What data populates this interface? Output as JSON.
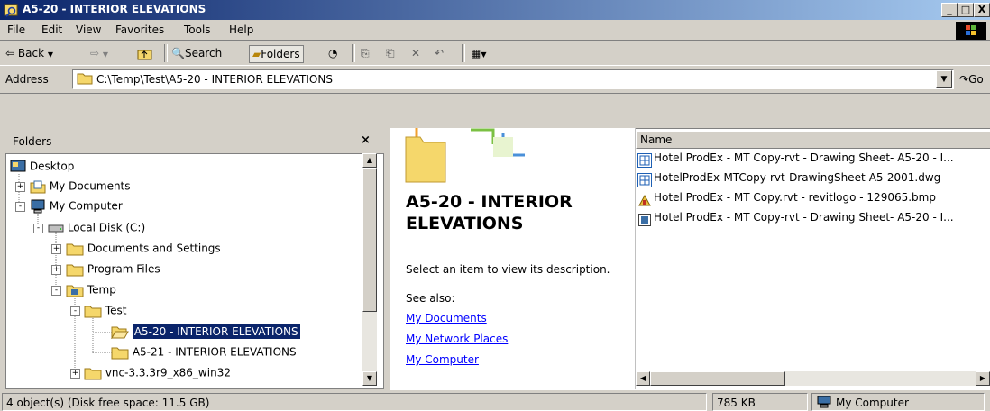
{
  "window": {
    "title": "A5-20 - INTERIOR ELEVATIONS",
    "minimize": "_",
    "maximize": "□",
    "close": "X"
  },
  "menu": [
    "File",
    "Edit",
    "View",
    "Favorites",
    "Tools",
    "Help"
  ],
  "toolbar": {
    "back": "Back",
    "search": "Search",
    "folders": "Folders"
  },
  "address": {
    "label": "Address",
    "value": "C:\\Temp\\Test\\A5-20 - INTERIOR ELEVATIONS",
    "go": "Go"
  },
  "folders_pane": {
    "title": "Folders",
    "close": "×",
    "tree": [
      {
        "label": "Desktop",
        "level": 0,
        "expander": ""
      },
      {
        "label": "My Documents",
        "level": 1,
        "expander": "+"
      },
      {
        "label": "My Computer",
        "level": 1,
        "expander": "-"
      },
      {
        "label": "Local Disk (C:)",
        "level": 2,
        "expander": "-"
      },
      {
        "label": "Documents and Settings",
        "level": 3,
        "expander": "+"
      },
      {
        "label": "Program Files",
        "level": 3,
        "expander": "+"
      },
      {
        "label": "Temp",
        "level": 3,
        "expander": "-"
      },
      {
        "label": "Test",
        "level": 4,
        "expander": "-"
      },
      {
        "label": "A5-20 - INTERIOR ELEVATIONS",
        "level": 5,
        "expander": "",
        "selected": true
      },
      {
        "label": "A5-21 - INTERIOR ELEVATIONS",
        "level": 5,
        "expander": ""
      },
      {
        "label": "vnc-3.3.3r9_x86_win32",
        "level": 4,
        "expander": "+"
      }
    ]
  },
  "webview": {
    "title": "A5-20 - INTERIOR ELEVATIONS",
    "description": "Select an item to view its description.",
    "see_also": "See also:",
    "links": [
      "My Documents",
      "My Network Places",
      "My Computer"
    ]
  },
  "file_list": {
    "column_name": "Name",
    "files": [
      {
        "name": "Hotel ProdEx - MT Copy-rvt - Drawing Sheet- A5-20 - I...",
        "icon": "dwf-icon"
      },
      {
        "name": "HotelProdEx-MTCopy-rvt-DrawingSheet-A5-2001.dwg",
        "icon": "dwg-icon"
      },
      {
        "name": "Hotel ProdEx - MT Copy.rvt - revitlogo - 129065.bmp",
        "icon": "bmp-icon"
      },
      {
        "name": "Hotel ProdEx - MT Copy-rvt - Drawing Sheet- A5-20 - I...",
        "icon": "html-icon"
      }
    ]
  },
  "status": {
    "objects": "4 object(s) (Disk free space: 11.5 GB)",
    "size": "785 KB",
    "zone": "My Computer"
  }
}
